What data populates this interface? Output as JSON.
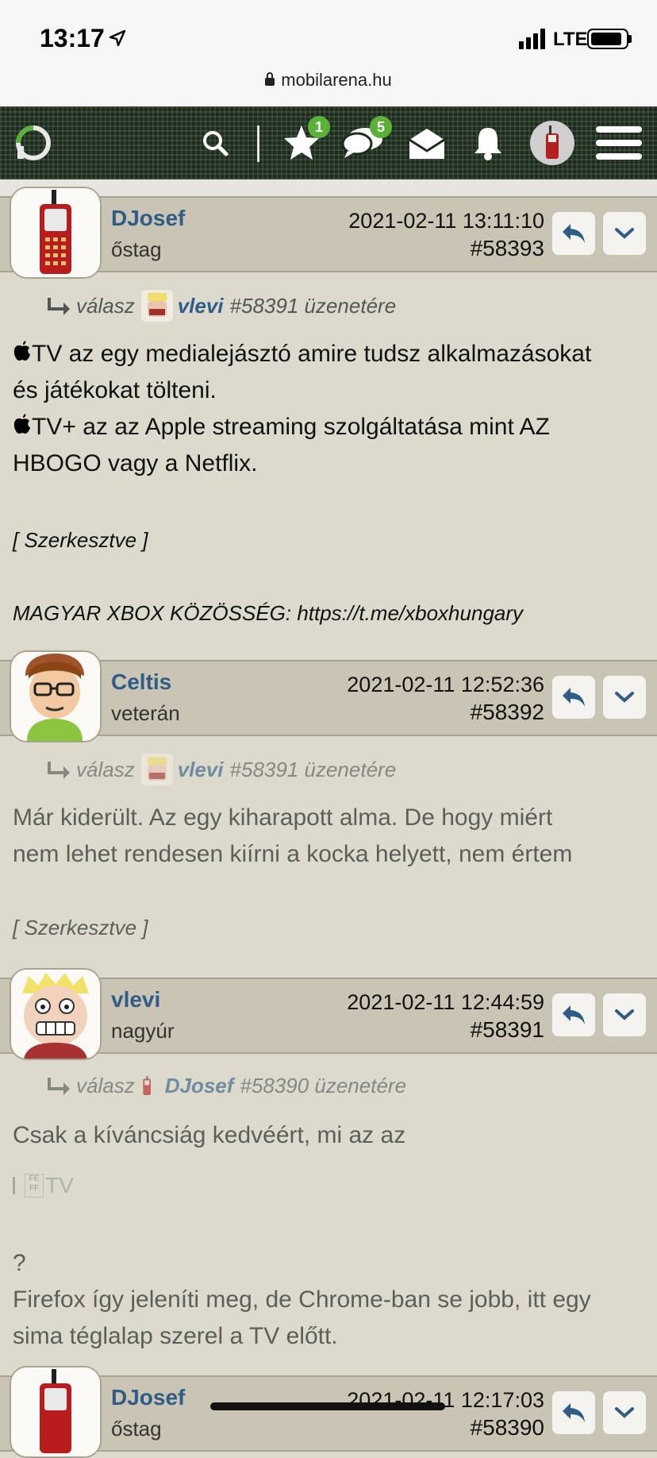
{
  "status_bar": {
    "time": "13:17",
    "network": "LTE",
    "url": "mobilarena.hu"
  },
  "nav": {
    "favorites_badge": "1",
    "messages_badge": "5"
  },
  "posts": [
    {
      "username": "DJosef",
      "rank": "őstag",
      "date": "2021-02-11 13:11:10",
      "number": "#58393",
      "reply_prefix": "válasz",
      "reply_to": "vlevi",
      "reply_suffix": "#58391 üzenetére",
      "body_lines": [
        "TV az egy medialejásztó amire tudsz alkalmazásokat",
        "és játékokat tölteni.",
        "TV+ az az Apple streaming szolgáltatása mint AZ",
        "HBOGO vagy a Netflix."
      ],
      "edited": "[ Szerkesztve ]",
      "signature": "MAGYAR XBOX KÖZÖSSÉG: https://t.me/xboxhungary"
    },
    {
      "username": "Celtis",
      "rank": "veterán",
      "date": "2021-02-11 12:52:36",
      "number": "#58392",
      "reply_prefix": "válasz",
      "reply_to": "vlevi",
      "reply_suffix": "#58391 üzenetére",
      "body_lines": [
        "Már kiderült. Az egy kiharapott alma. De hogy miért",
        "nem lehet rendesen kiírni a kocka helyett, nem értem"
      ],
      "edited": "[ Szerkesztve ]"
    },
    {
      "username": "vlevi",
      "rank": "nagyúr",
      "date": "2021-02-11 12:44:59",
      "number": "#58391",
      "reply_prefix": "válasz",
      "reply_to": "DJosef",
      "reply_suffix": "#58390 üzenetére",
      "body_lines": [
        "Csak a kíváncsiág kedvéért, mi az az"
      ],
      "tv_snippet": "TV",
      "glyph_box": "FE\nFF",
      "body_after": [
        "?",
        "Firefox így jeleníti meg, de Chrome-ban se jobb, itt egy",
        "sima téglalap szerel a TV előtt."
      ]
    },
    {
      "username": "DJosef",
      "rank": "őstag",
      "date": "2021-02-11 12:17:03",
      "number": "#58390"
    }
  ]
}
